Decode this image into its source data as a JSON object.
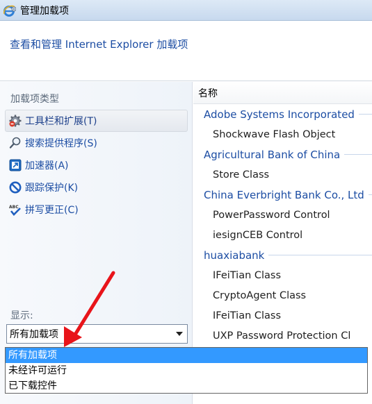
{
  "window": {
    "title": "管理加载项"
  },
  "header": {
    "headline": "查看和管理 Internet Explorer 加载项"
  },
  "left": {
    "section_label": "加载项类型",
    "types": [
      {
        "label": "工具栏和扩展(T)",
        "icon": "gear-icon",
        "selected": true
      },
      {
        "label": "搜索提供程序(S)",
        "icon": "search-icon",
        "selected": false
      },
      {
        "label": "加速器(A)",
        "icon": "accelerator-icon",
        "selected": false
      },
      {
        "label": "跟踪保护(K)",
        "icon": "block-icon",
        "selected": false
      },
      {
        "label": "拼写更正(C)",
        "icon": "spellcheck-icon",
        "selected": false
      }
    ],
    "show_label": "显示:",
    "show_value": "所有加载项",
    "show_options": [
      "所有加载项",
      "未经许可运行",
      "已下载控件"
    ]
  },
  "list": {
    "column_name": "名称",
    "groups": [
      {
        "publisher": "Adobe Systems Incorporated",
        "items": [
          "Shockwave Flash Object"
        ]
      },
      {
        "publisher": "Agricultural Bank of China",
        "items": [
          "Store Class"
        ]
      },
      {
        "publisher": "China Everbright Bank Co., Ltd",
        "items": [
          "PowerPassword Control",
          "iesignCEB Control"
        ]
      },
      {
        "publisher": "huaxiabank",
        "items": [
          "IFeiTian Class",
          "CryptoAgent Class",
          "IFeiTian Class",
          "UXP Password Protection Cl"
        ]
      }
    ]
  },
  "colors": {
    "link_blue": "#1c4da3",
    "highlight": "#3399ff",
    "annotation_red": "#e8141a"
  }
}
